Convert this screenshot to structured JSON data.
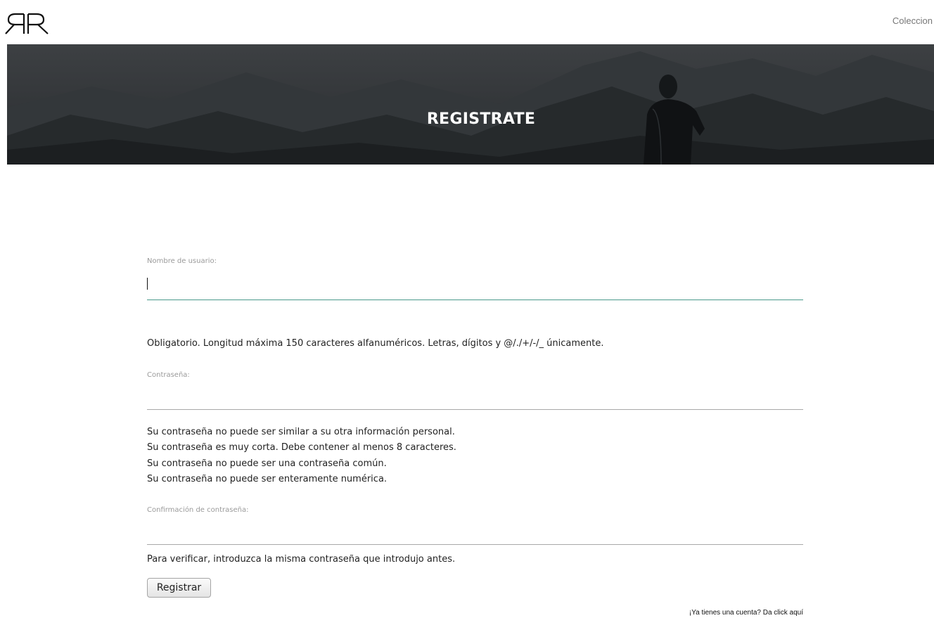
{
  "header": {
    "logo_icon": "rr-monogram-logo",
    "nav_link": "Coleccion"
  },
  "hero": {
    "title": "REGISTRATE"
  },
  "form": {
    "username": {
      "label": "Nombre de usuario:",
      "value": "",
      "help": "Obligatorio. Longitud máxima 150 caracteres alfanuméricos. Letras, dígitos y @/./+/-/_ únicamente."
    },
    "password": {
      "label": "Contraseña:",
      "value": "",
      "help": [
        "Su contraseña no puede ser similar a su otra información personal.",
        "Su contraseña es muy corta. Debe contener al menos 8 caracteres.",
        "Su contraseña no puede ser una contraseña común.",
        "Su contraseña no puede ser enteramente numérica."
      ]
    },
    "password_confirm": {
      "label": "Confirmación de contraseña:",
      "value": "",
      "help": "Para verificar, introduzca la misma contraseña que introdujo antes."
    },
    "submit_label": "Registrar"
  },
  "footer": {
    "login_link": "¡Ya tienes una cuenta? Da click aquí"
  },
  "colors": {
    "active_underline": "#4a9a8a",
    "underline": "#a8a8a8"
  }
}
